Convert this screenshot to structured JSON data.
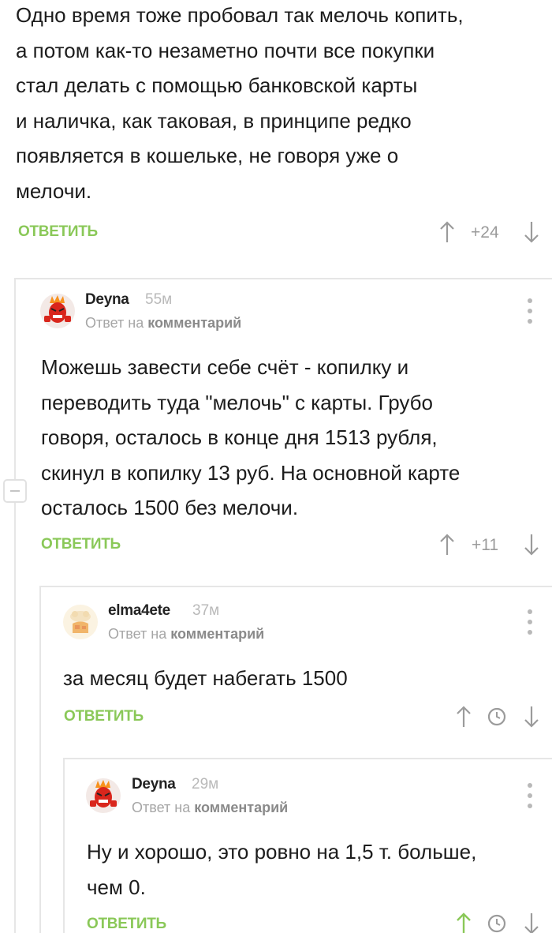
{
  "root": {
    "text": "Одно время тоже пробовал так мелочь копить,\nа потом как-то незаметно почти все покупки\nстал делать с помощью банковской карты\nи наличка, как таковая, в принципе редко\nпоявляется в кошельке, не говоря уже о\nмелочи.",
    "reply_label": "ОТВЕТИТЬ",
    "rating": "+24"
  },
  "comments": [
    {
      "author": "Deyna",
      "time": "55м",
      "meta_prefix": "Ответ на",
      "meta_link": "комментарий",
      "text": "Можешь завести себе счёт - копилку и\nпереводить туда \"мелочь\" с карты. Грубо\nговоря, осталось в конце дня 1513 рубля,\nскинул в копилку 13 руб. На основной карте\nосталось 1500 без мелочи.",
      "reply_label": "ОТВЕТИТЬ",
      "rating": "+11"
    },
    {
      "author": "elma4ete",
      "time": "37м",
      "meta_prefix": "Ответ на",
      "meta_link": "комментарий",
      "text": "за месяц будет набегать 1500",
      "reply_label": "ОТВЕТИТЬ"
    },
    {
      "author": "Deyna",
      "time": "29м",
      "meta_prefix": "Ответ на",
      "meta_link": "комментарий",
      "text": "Ну и хорошо, это ровно на 1,5 т. больше,\nчем 0.",
      "reply_label": "ОТВЕТИТЬ"
    }
  ],
  "colors": {
    "accent": "#8ac858",
    "muted": "#a6a6a6",
    "thread_line": "#e6e6e6"
  }
}
